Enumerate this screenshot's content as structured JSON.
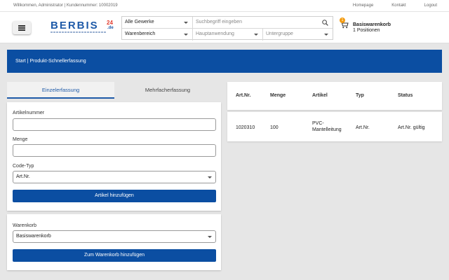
{
  "topbar": {
    "welcome": "Willkommen, Administrator | Kundennummer: 10002019",
    "links": [
      "Homepage",
      "Kontakt",
      "Logout"
    ]
  },
  "logo": {
    "word": "BERBIS",
    "sup": "24",
    "de": ".de"
  },
  "search": {
    "trade_select": "Alle Gewerke",
    "placeholder": "Suchbegriff eingeben",
    "category": "Warenbereich",
    "main_application": "Hauptanwendung",
    "subgroup": "Untergruppe"
  },
  "cart": {
    "badge": "1",
    "name": "Basiswarenkorb",
    "positions": "1 Positionen"
  },
  "breadcrumb": "Start | Produkt-Schnellerfassung",
  "tabs": {
    "single": "Einzelerfassung",
    "multi": "Mehrfacherfassung"
  },
  "form": {
    "article_number_label": "Artikelnummer",
    "article_number_value": "",
    "quantity_label": "Menge",
    "quantity_value": "",
    "code_type_label": "Code-Typ",
    "code_type_value": "Art.Nr.",
    "add_button": "Artikel hinzufügen"
  },
  "cart_form": {
    "label": "Warenkorb",
    "value": "Basiswarenkorb",
    "add_button": "Zum Warenkorb hinzufügen"
  },
  "table": {
    "headers": [
      "Art.Nr.",
      "Menge",
      "Artikel",
      "Typ",
      "Status"
    ],
    "rows": [
      {
        "art_nr": "1020310",
        "menge": "100",
        "artikel_line1": "PVC-",
        "artikel_line2": "Mantelleitung",
        "typ": "Art.Nr.",
        "status": "Art.Nr. gültig"
      }
    ]
  },
  "colors": {
    "primary": "#0b4ea2",
    "accent": "#e23b2e",
    "badge": "#f39c12"
  }
}
